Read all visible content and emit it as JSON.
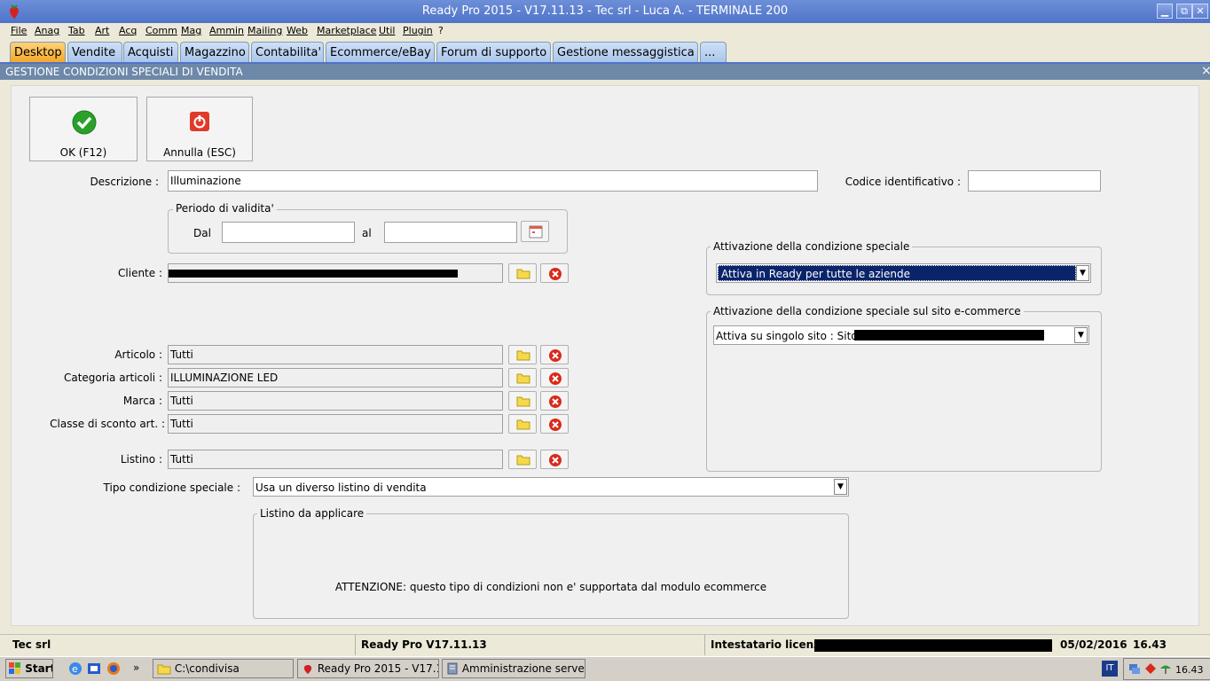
{
  "window": {
    "title": "Ready Pro 2015 - V17.11.13 - Tec srl - Luca A. - TERMINALE 200",
    "min": "▁",
    "restore": "⧉",
    "close": "✕"
  },
  "menu": [
    "File",
    "Anag",
    "Tab",
    "Art",
    "Acq",
    "Comm",
    "Mag",
    "Ammin",
    "Mailing",
    "Web",
    "Marketplace",
    "Util",
    "Plugin",
    "?"
  ],
  "tabs": [
    "Desktop",
    "Vendite",
    "Acquisti",
    "Magazzino",
    "Contabilita'",
    "Ecommerce/eBay",
    "Forum di supporto",
    "Gestione messaggistica",
    "..."
  ],
  "section": {
    "title": "GESTIONE CONDIZIONI SPECIALI DI VENDITA",
    "close": "×"
  },
  "toolbar": {
    "ok_label": "OK (F12)",
    "cancel_label": "Annulla (ESC)"
  },
  "form": {
    "descrizione_label": "Descrizione :",
    "descrizione_value": "Illuminazione",
    "codice_label": "Codice identificativo :",
    "codice_value": "",
    "periodo_title": "Periodo di validita'",
    "dal_label": "Dal",
    "dal_value": "",
    "al_label": "al",
    "al_value": "",
    "cliente_label": "Cliente :",
    "articolo_label": "Articolo :",
    "articolo_value": "Tutti",
    "categoria_label": "Categoria articoli :",
    "categoria_value": "ILLUMINAZIONE LED",
    "marca_label": "Marca :",
    "marca_value": "Tutti",
    "classe_label": "Classe di sconto art. :",
    "classe_value": "Tutti",
    "listino_label": "Listino :",
    "listino_value": "Tutti",
    "tipo_label": "Tipo condizione speciale :",
    "tipo_value": "Usa un diverso listino di vendita",
    "listino_app_title": "Listino da applicare",
    "warning": "ATTENZIONE: questo tipo di condizioni non e' supportata dal modulo ecommerce"
  },
  "attivazione": {
    "title": "Attivazione della condizione speciale",
    "value": "Attiva in Ready per tutte le aziende"
  },
  "attivazione_sito": {
    "title": "Attivazione della condizione speciale sul sito e-commerce",
    "value": "Attiva su singolo sito : Sito"
  },
  "status": {
    "company": "Tec srl",
    "version": "Ready Pro V17.11.13",
    "licenza_label": "Intestatario licenza :",
    "date": "05/02/2016",
    "time": "16.43"
  },
  "taskbar": {
    "start": "Start",
    "chevron": "»",
    "tasks": [
      "C:\\condivisa",
      "Ready Pro 2015 - V17.1...",
      "Amministrazione server"
    ],
    "lang": "IT",
    "clock": "16.43"
  },
  "colors": {
    "accent": "#4f73c8",
    "selected": "#0a246a",
    "active_tab": "#f4a623",
    "header": "#6d88a8"
  }
}
